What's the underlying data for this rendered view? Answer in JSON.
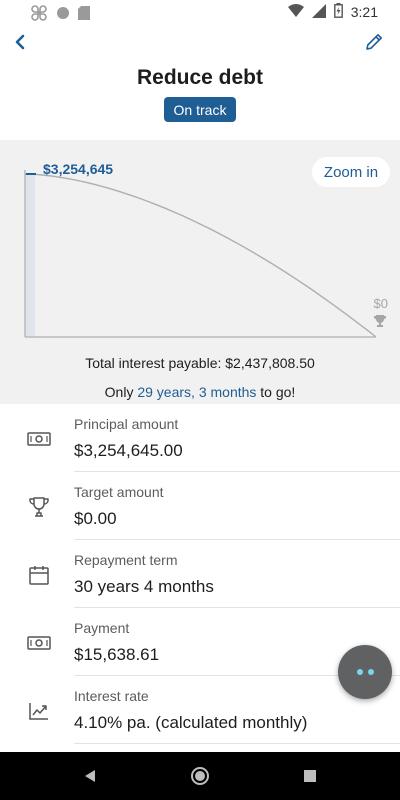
{
  "status_bar": {
    "time": "3:21",
    "icons": [
      "app-icon",
      "circle-icon",
      "sd-card-icon",
      "wifi-icon",
      "signal-icon",
      "battery-icon"
    ]
  },
  "header": {
    "title": "Reduce debt",
    "status_badge": "On track",
    "back_icon": "chevron-left-icon",
    "edit_icon": "pencil-icon"
  },
  "chart": {
    "start_label": "$3,254,645",
    "end_label": "$0",
    "zoom_label": "Zoom in",
    "total_interest": "Total interest payable: $2,437,808.50",
    "remaining_prefix": "Only ",
    "remaining_highlight": "29 years, 3 months",
    "remaining_suffix": " to go!"
  },
  "chart_data": {
    "type": "line",
    "title": "",
    "series": [
      {
        "values": [
          3254645,
          0
        ]
      }
    ],
    "ylim": [
      0,
      3254645
    ]
  },
  "details": [
    {
      "icon": "cash-icon",
      "label": "Principal amount",
      "value": "$3,254,645.00"
    },
    {
      "icon": "trophy-icon",
      "label": "Target amount",
      "value": "$0.00"
    },
    {
      "icon": "calendar-icon",
      "label": "Repayment term",
      "value": "30 years 4 months"
    },
    {
      "icon": "cash-icon",
      "label": "Payment",
      "value": "$15,638.61"
    },
    {
      "icon": "trending-up-icon",
      "label": "Interest rate",
      "value": "4.10% pa. (calculated monthly)"
    }
  ],
  "colors": {
    "accent": "#1f5d95",
    "panel": "#f1f1f2",
    "fab": "#5f6162",
    "fab_dots": "#7fd3ee"
  }
}
